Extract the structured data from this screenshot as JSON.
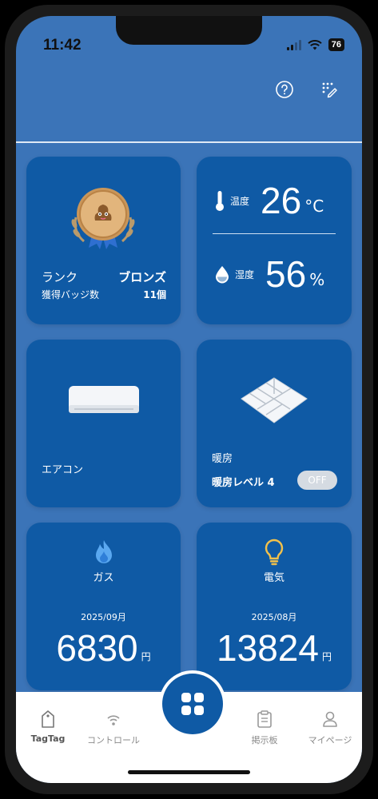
{
  "status_bar": {
    "time": "11:42",
    "battery": "76"
  },
  "rank_card": {
    "rank_label": "ランク",
    "rank_value": "ブロンズ",
    "badge_label": "獲得バッジ数",
    "badge_value": "11個"
  },
  "environment": {
    "temperature": {
      "label": "温度",
      "value": "26",
      "unit": "°C"
    },
    "humidity": {
      "label": "湿度",
      "value": "56",
      "unit": "%"
    }
  },
  "aircon": {
    "label": "エアコン"
  },
  "heating": {
    "label": "暖房",
    "level": "暖房レベル 4",
    "toggle": "OFF"
  },
  "gas": {
    "name": "ガス",
    "month": "2025/09月",
    "amount": "6830",
    "unit": "円"
  },
  "electricity": {
    "name": "電気",
    "month": "2025/08月",
    "amount": "13824",
    "unit": "円"
  },
  "tabs": [
    {
      "label": "TagTag"
    },
    {
      "label": "コントロール"
    },
    {
      "label": "掲示板"
    },
    {
      "label": "マイページ"
    }
  ],
  "colors": {
    "background": "#3b74b8",
    "card": "#0f5aa5",
    "gas_icon": "#5aa8f0",
    "bulb_icon": "#f2c14b"
  }
}
